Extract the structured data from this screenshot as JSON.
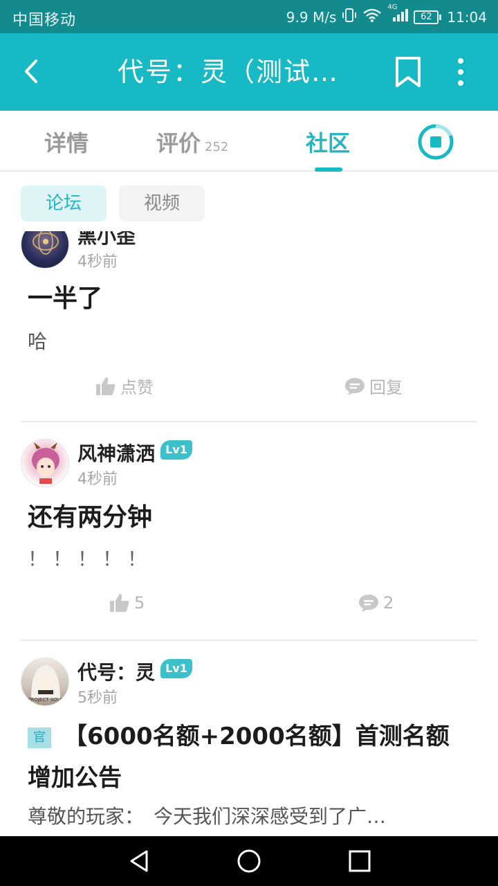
{
  "status_bar": {
    "carrier": "中国移动",
    "speed": "9.9 M/s",
    "network": "4G",
    "battery": "62",
    "time": "11:04"
  },
  "header": {
    "title": "代号：灵（测试…",
    "back_icon": "chevron-left-icon",
    "bookmark_icon": "bookmark-icon",
    "more_icon": "more-vertical-icon"
  },
  "tabs": [
    {
      "label": "详情",
      "count": ""
    },
    {
      "label": "评价",
      "count": "252"
    },
    {
      "label": "社区",
      "count": ""
    }
  ],
  "sub_tabs": [
    {
      "label": "论坛"
    },
    {
      "label": "视频"
    }
  ],
  "posts": [
    {
      "username": "黑小歪",
      "time": "4秒前",
      "title": "一半了",
      "body": "哈",
      "like_label": "点赞",
      "reply_label": "回复"
    },
    {
      "username": "风神潇洒",
      "level": "Lv1",
      "time": "4秒前",
      "title": "还有两分钟",
      "body": "！！！！！",
      "like_label": "5",
      "reply_label": "2"
    },
    {
      "username": "代号：灵",
      "level": "Lv1",
      "time": "5秒前",
      "badge": "官",
      "title": "【6000名额+2000名额】首测名额增加公告",
      "body": "尊敬的玩家：　今天我们深深感受到了广…",
      "avatar_text": "PROJECT SOUL"
    }
  ],
  "colors": {
    "status_bar": "#138a8e",
    "app_bar": "#17b9c5",
    "accent": "#26b6c2"
  }
}
